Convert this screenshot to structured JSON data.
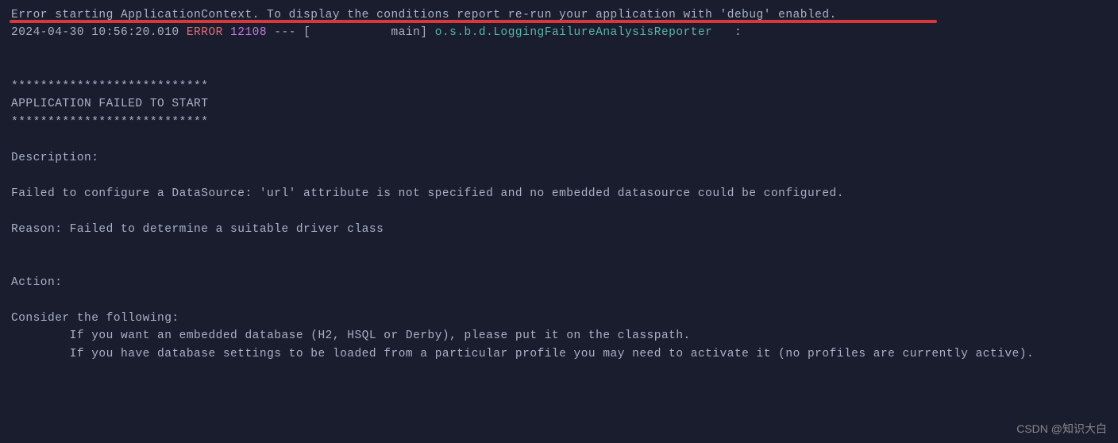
{
  "log": {
    "line1": "Error starting ApplicationContext. To display the conditions report re-run your application with 'debug' enabled.",
    "timestamp": "2024-04-30 10:56:20.010 ",
    "level": "ERROR",
    "pid": " 12108",
    "threadPrefix": " --- [           main] ",
    "logger": "o.s.b.d.LoggingFailureAnalysisReporter",
    "loggerSuffix": "   :",
    "stars": "***************************",
    "failHeader": "APPLICATION FAILED TO START",
    "descHeader": "Description:",
    "descText": "Failed to configure a DataSource: 'url' attribute is not specified and no embedded datasource could be configured.",
    "reasonText": "Reason: Failed to determine a suitable driver class",
    "actionHeader": "Action:",
    "considerHeader": "Consider the following:",
    "considerLine1": "\tIf you want an embedded database (H2, HSQL or Derby), please put it on the classpath.",
    "considerLine2": "\tIf you have database settings to be loaded from a particular profile you may need to activate it (no profiles are currently active)."
  },
  "watermark": "CSDN @知识大白"
}
